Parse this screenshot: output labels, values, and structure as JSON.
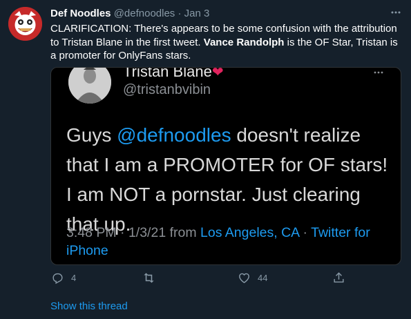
{
  "tweet": {
    "author_name": "Def Noodles",
    "author_handle": "@defnoodles",
    "separator": "·",
    "date": "Jan 3",
    "text_prefix": "CLARIFICATION: There's appears to be some confusion with the attribution to Tristan Blane in the first tweet. ",
    "text_bold": "Vance Randolph",
    "text_suffix": " is the OF Star, Tristan is a promoter for OnlyFans stars.",
    "reply_count": "4",
    "like_count": "44",
    "show_thread": "Show this thread"
  },
  "embedded": {
    "name": "Tristan Blane",
    "name_emoji": "❤",
    "handle": "@tristanbvibin",
    "text_1": "Guys ",
    "mention": "@defnoodles",
    "text_2": " doesn't realize that I am a PROMOTER for OF stars! I am NOT a pornstar. Just clearing that up.",
    "time": "3:48 PM · 1/3/21 from ",
    "location": "Los Angeles, CA",
    "meta_sep": " · ",
    "source": "Twitter for iPhone"
  },
  "icons": {
    "more": "more-horizontal-icon",
    "reply": "reply-icon",
    "retweet": "retweet-icon",
    "like": "heart-icon",
    "share": "share-icon"
  },
  "colors": {
    "background": "#15202b",
    "accent": "#1d9bf0",
    "muted": "#8899a6",
    "embed_bg": "#000000"
  }
}
